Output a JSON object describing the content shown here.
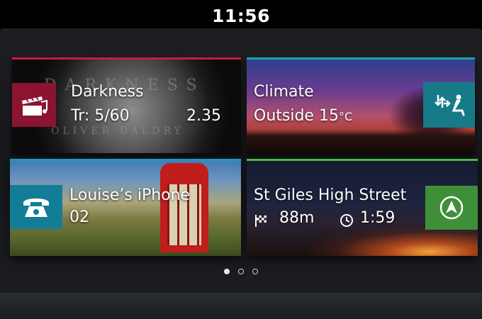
{
  "status_bar": {
    "time": "11:56"
  },
  "tiles": {
    "music": {
      "title": "Darkness",
      "track": "Tr: 5/60",
      "time": "2.35",
      "album_art_text_top": "DARKNESS",
      "album_art_text_bottom": "OLIVER DALDRY",
      "accent_color": "#c81b3f",
      "icon": "music-film-icon"
    },
    "climate": {
      "title": "Climate",
      "outside_label": "Outside 15",
      "unit": "°C",
      "accent_color": "#1aa6a6",
      "icon": "airflow-seat-icon"
    },
    "phone": {
      "title": "Louise’s iPhone",
      "carrier": "02",
      "accent_color": "#1a9bbf",
      "icon": "phone-icon"
    },
    "navigation": {
      "street": "St Giles High Street",
      "distance": "88m",
      "eta": "1:59",
      "accent_color": "#4bb84b",
      "icon": "navigation-arrow-icon"
    }
  },
  "pagination": {
    "total": 3,
    "active": 1
  }
}
